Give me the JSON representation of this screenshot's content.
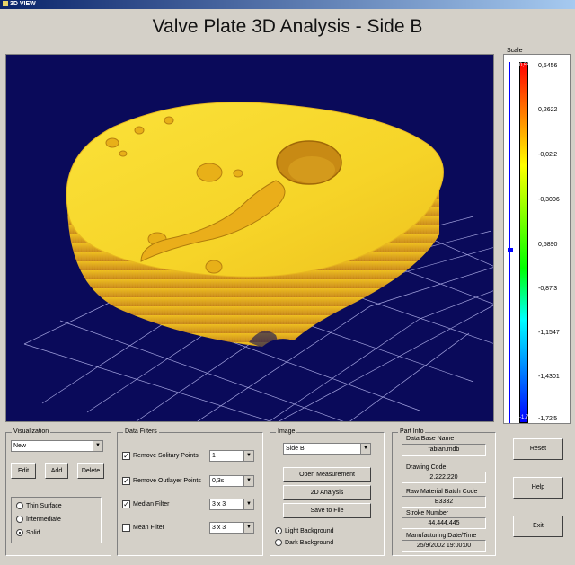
{
  "window": {
    "title": "3D VIEW"
  },
  "page_title": "Valve Plate 3D Analysis - Side B",
  "scale": {
    "label": "Scale",
    "top_value": "0,55",
    "bottom_value": "-1,72",
    "values": [
      "0,5456",
      "0,2622",
      "-0,02'2",
      "-0,3006",
      "0,5890",
      "-0,87'3",
      "-1,1547",
      "-1,4301",
      "-1,72'5"
    ],
    "slider_position": 0.52
  },
  "visualization": {
    "legend": "Visualization",
    "selected": "New",
    "edit_label": "Edit",
    "add_label": "Add",
    "delete_label": "Delete",
    "modes": [
      "Thin Surface",
      "Intermediate",
      "Solid"
    ],
    "selected_mode": "Solid"
  },
  "data_filters": {
    "legend": "Data Filters",
    "filters": [
      {
        "label": "Remove Solitary Points",
        "checked": true,
        "value": "1"
      },
      {
        "label": "Remove Outlayer Points",
        "checked": true,
        "value": "0,3s"
      },
      {
        "label": "Median Filter",
        "checked": true,
        "value": "3 x 3"
      },
      {
        "label": "Mean Filter",
        "checked": false,
        "value": "3 x 3"
      }
    ]
  },
  "image": {
    "legend": "Image",
    "selected": "Side B",
    "open_measurement_label": "Open Measurement",
    "analysis_2d_label": "2D Analysis",
    "save_label": "Save to File",
    "backgrounds": [
      "Light Background",
      "Dark Background"
    ],
    "selected_background": "Light Background"
  },
  "part_info": {
    "legend": "Part Info",
    "database_label": "Data Base Name",
    "database_value": "fabian.mdb",
    "drawing_code_label": "Drawing Code",
    "drawing_code_value": "2.222.220",
    "batch_code_label": "Raw Material Batch Code",
    "batch_code_value": "E3332",
    "stroke_label": "Stroke Number",
    "stroke_value": "44.444.445",
    "date_label": "Manufacturing Date/Time",
    "date_value": "25/9/2002 19:00:00"
  },
  "side_buttons": {
    "reset_label": "Reset",
    "help_label": "Help",
    "exit_label": "Exit"
  },
  "colors": {
    "viewport_bg": "#0a0a5a",
    "part_top": "#f6d428",
    "part_side": "#e8a820",
    "grid": "#c8c8ff"
  }
}
